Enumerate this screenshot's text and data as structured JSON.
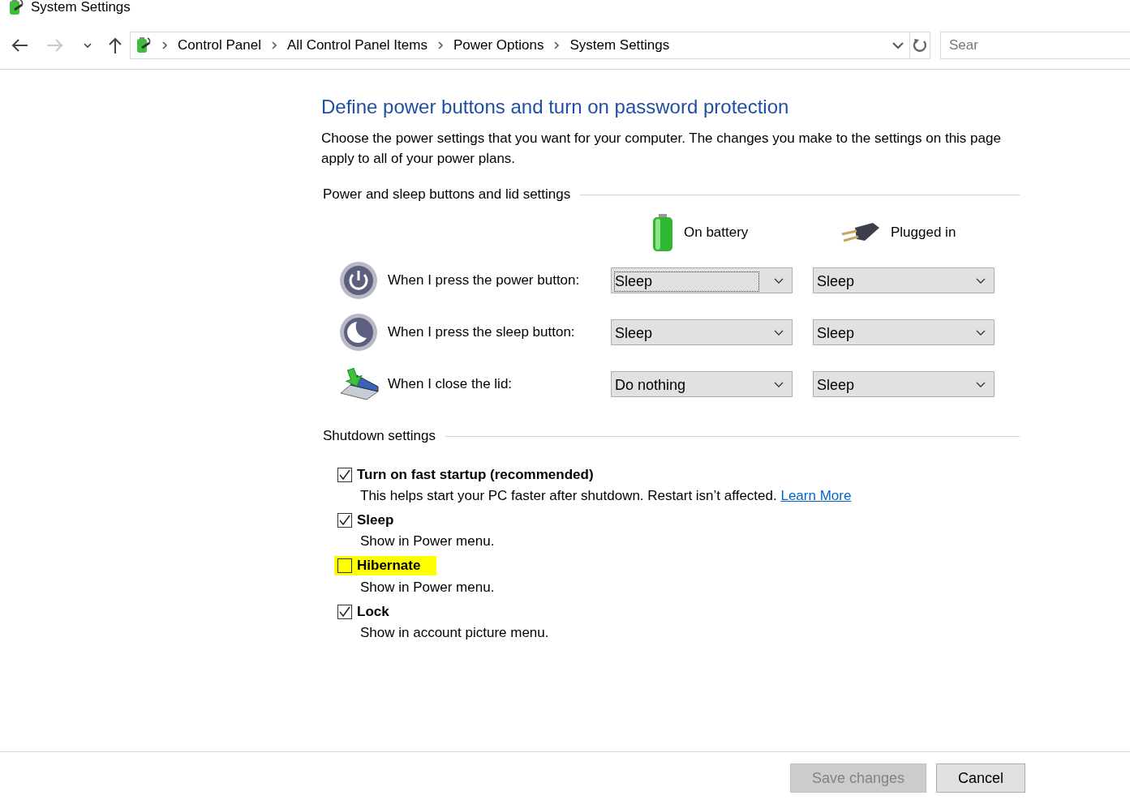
{
  "window": {
    "title": "System Settings"
  },
  "nav_buttons": [
    {
      "kind": "back",
      "disabled": false
    },
    {
      "kind": "forward",
      "disabled": true
    },
    {
      "kind": "recent",
      "disabled": false
    },
    {
      "kind": "up",
      "disabled": false
    }
  ],
  "address_bar": {
    "breadcrumbs": [
      "Control Panel",
      "All Control Panel Items",
      "Power Options",
      "System Settings"
    ]
  },
  "search": {
    "placeholder": "Sear"
  },
  "page": {
    "heading": "Define power buttons and turn on password protection",
    "intro": "Choose the power settings that you want for your computer. The changes you make to the settings on this page apply to all of your power plans.",
    "buttons_section": {
      "title": "Power and sleep buttons and lid settings",
      "columns": [
        {
          "kind": "battery",
          "label": "On battery"
        },
        {
          "kind": "plug",
          "label": "Plugged in"
        }
      ],
      "rows": [
        {
          "kind": "power",
          "label": "When I press the power button:",
          "values": [
            {
              "value": "Sleep",
              "focused": true
            },
            {
              "value": "Sleep",
              "focused": false
            }
          ]
        },
        {
          "kind": "sleep",
          "label": "When I press the sleep button:",
          "values": [
            {
              "value": "Sleep",
              "focused": false
            },
            {
              "value": "Sleep",
              "focused": false
            }
          ]
        },
        {
          "kind": "lid",
          "label": "When I close the lid:",
          "values": [
            {
              "value": "Do nothing",
              "focused": false
            },
            {
              "value": "Sleep",
              "focused": false
            }
          ]
        }
      ]
    },
    "shutdown_section": {
      "title": "Shutdown settings",
      "items": [
        {
          "label": "Turn on fast startup (recommended)",
          "checked": true,
          "highlighted": false,
          "description": "This helps start your PC faster after shutdown. Restart isn’t affected.",
          "link": "Learn More"
        },
        {
          "label": "Sleep",
          "checked": true,
          "highlighted": false,
          "description": "Show in Power menu."
        },
        {
          "label": "Hibernate",
          "checked": false,
          "highlighted": true,
          "description": "Show in Power menu."
        },
        {
          "label": "Lock",
          "checked": true,
          "highlighted": false,
          "description": "Show in account picture menu."
        }
      ]
    }
  },
  "footer": {
    "buttons": [
      {
        "label": "Save changes",
        "disabled": true
      },
      {
        "label": "Cancel",
        "disabled": false
      }
    ]
  }
}
